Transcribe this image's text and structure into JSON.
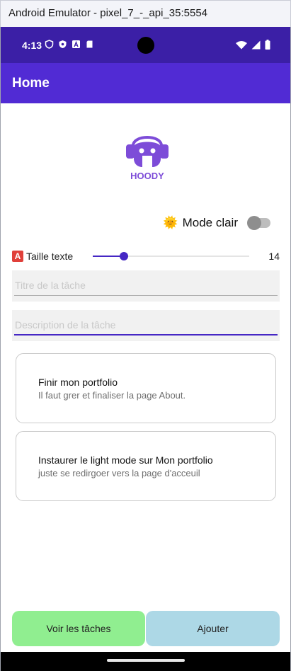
{
  "window": {
    "title": "Android Emulator - pixel_7_-_api_35:5554"
  },
  "status_bar": {
    "time": "4:13",
    "icons_left": [
      "shield-icon",
      "vpn-icon",
      "app-a-icon",
      "sd-card-icon"
    ],
    "icons_right": [
      "wifi-icon",
      "signal-icon",
      "battery-icon"
    ]
  },
  "app_bar": {
    "title": "Home"
  },
  "logo": {
    "text": "HOODY",
    "color": "#7d4cd8"
  },
  "theme": {
    "emoji": "🌞",
    "label": "Mode clair",
    "toggle_on": false
  },
  "text_size": {
    "emoji": "🅰",
    "label": "Taille texte",
    "value": "14",
    "fraction": 0.2
  },
  "inputs": {
    "title": {
      "placeholder": "Titre de la tâche",
      "value": ""
    },
    "description": {
      "placeholder": "Description de la tâche",
      "value": ""
    }
  },
  "tasks": [
    {
      "title": "Finir mon portfolio",
      "description": "Il faut grer et finaliser la page About."
    },
    {
      "title": "Instaurer le light mode sur Mon portfolio",
      "description": "juste se redirgoer vers la page d'acceuil"
    }
  ],
  "buttons": {
    "view": "Voir les tâches",
    "add": "Ajouter"
  },
  "colors": {
    "status_bar": "#3b1fa6",
    "app_bar": "#512bd4",
    "accent": "#4527c4",
    "view_button": "#90ee90",
    "add_button": "#add8e6"
  }
}
